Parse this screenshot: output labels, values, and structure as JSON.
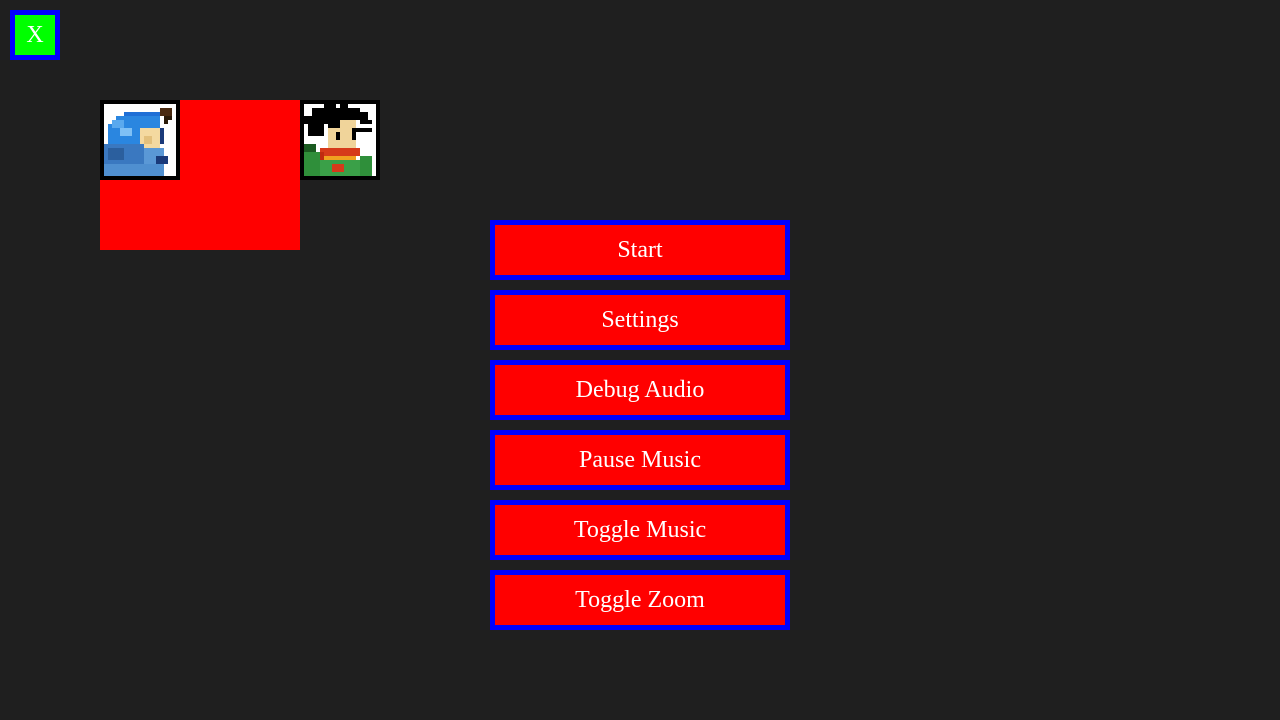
{
  "close_button": {
    "label": "X",
    "icon": "close-icon"
  },
  "portraits": [
    {
      "icon": "blue-haired-character-portrait"
    },
    {
      "icon": "black-haired-character-portrait"
    }
  ],
  "menu": {
    "buttons": [
      {
        "label": "Start"
      },
      {
        "label": "Settings"
      },
      {
        "label": "Debug Audio"
      },
      {
        "label": "Pause Music"
      },
      {
        "label": "Toggle Music"
      },
      {
        "label": "Toggle Zoom"
      }
    ]
  },
  "colors": {
    "background": "#1f1f1f",
    "button_fill": "#ff0000",
    "button_border": "#0000ff",
    "close_fill": "#00ff00",
    "text": "#ffffff"
  }
}
